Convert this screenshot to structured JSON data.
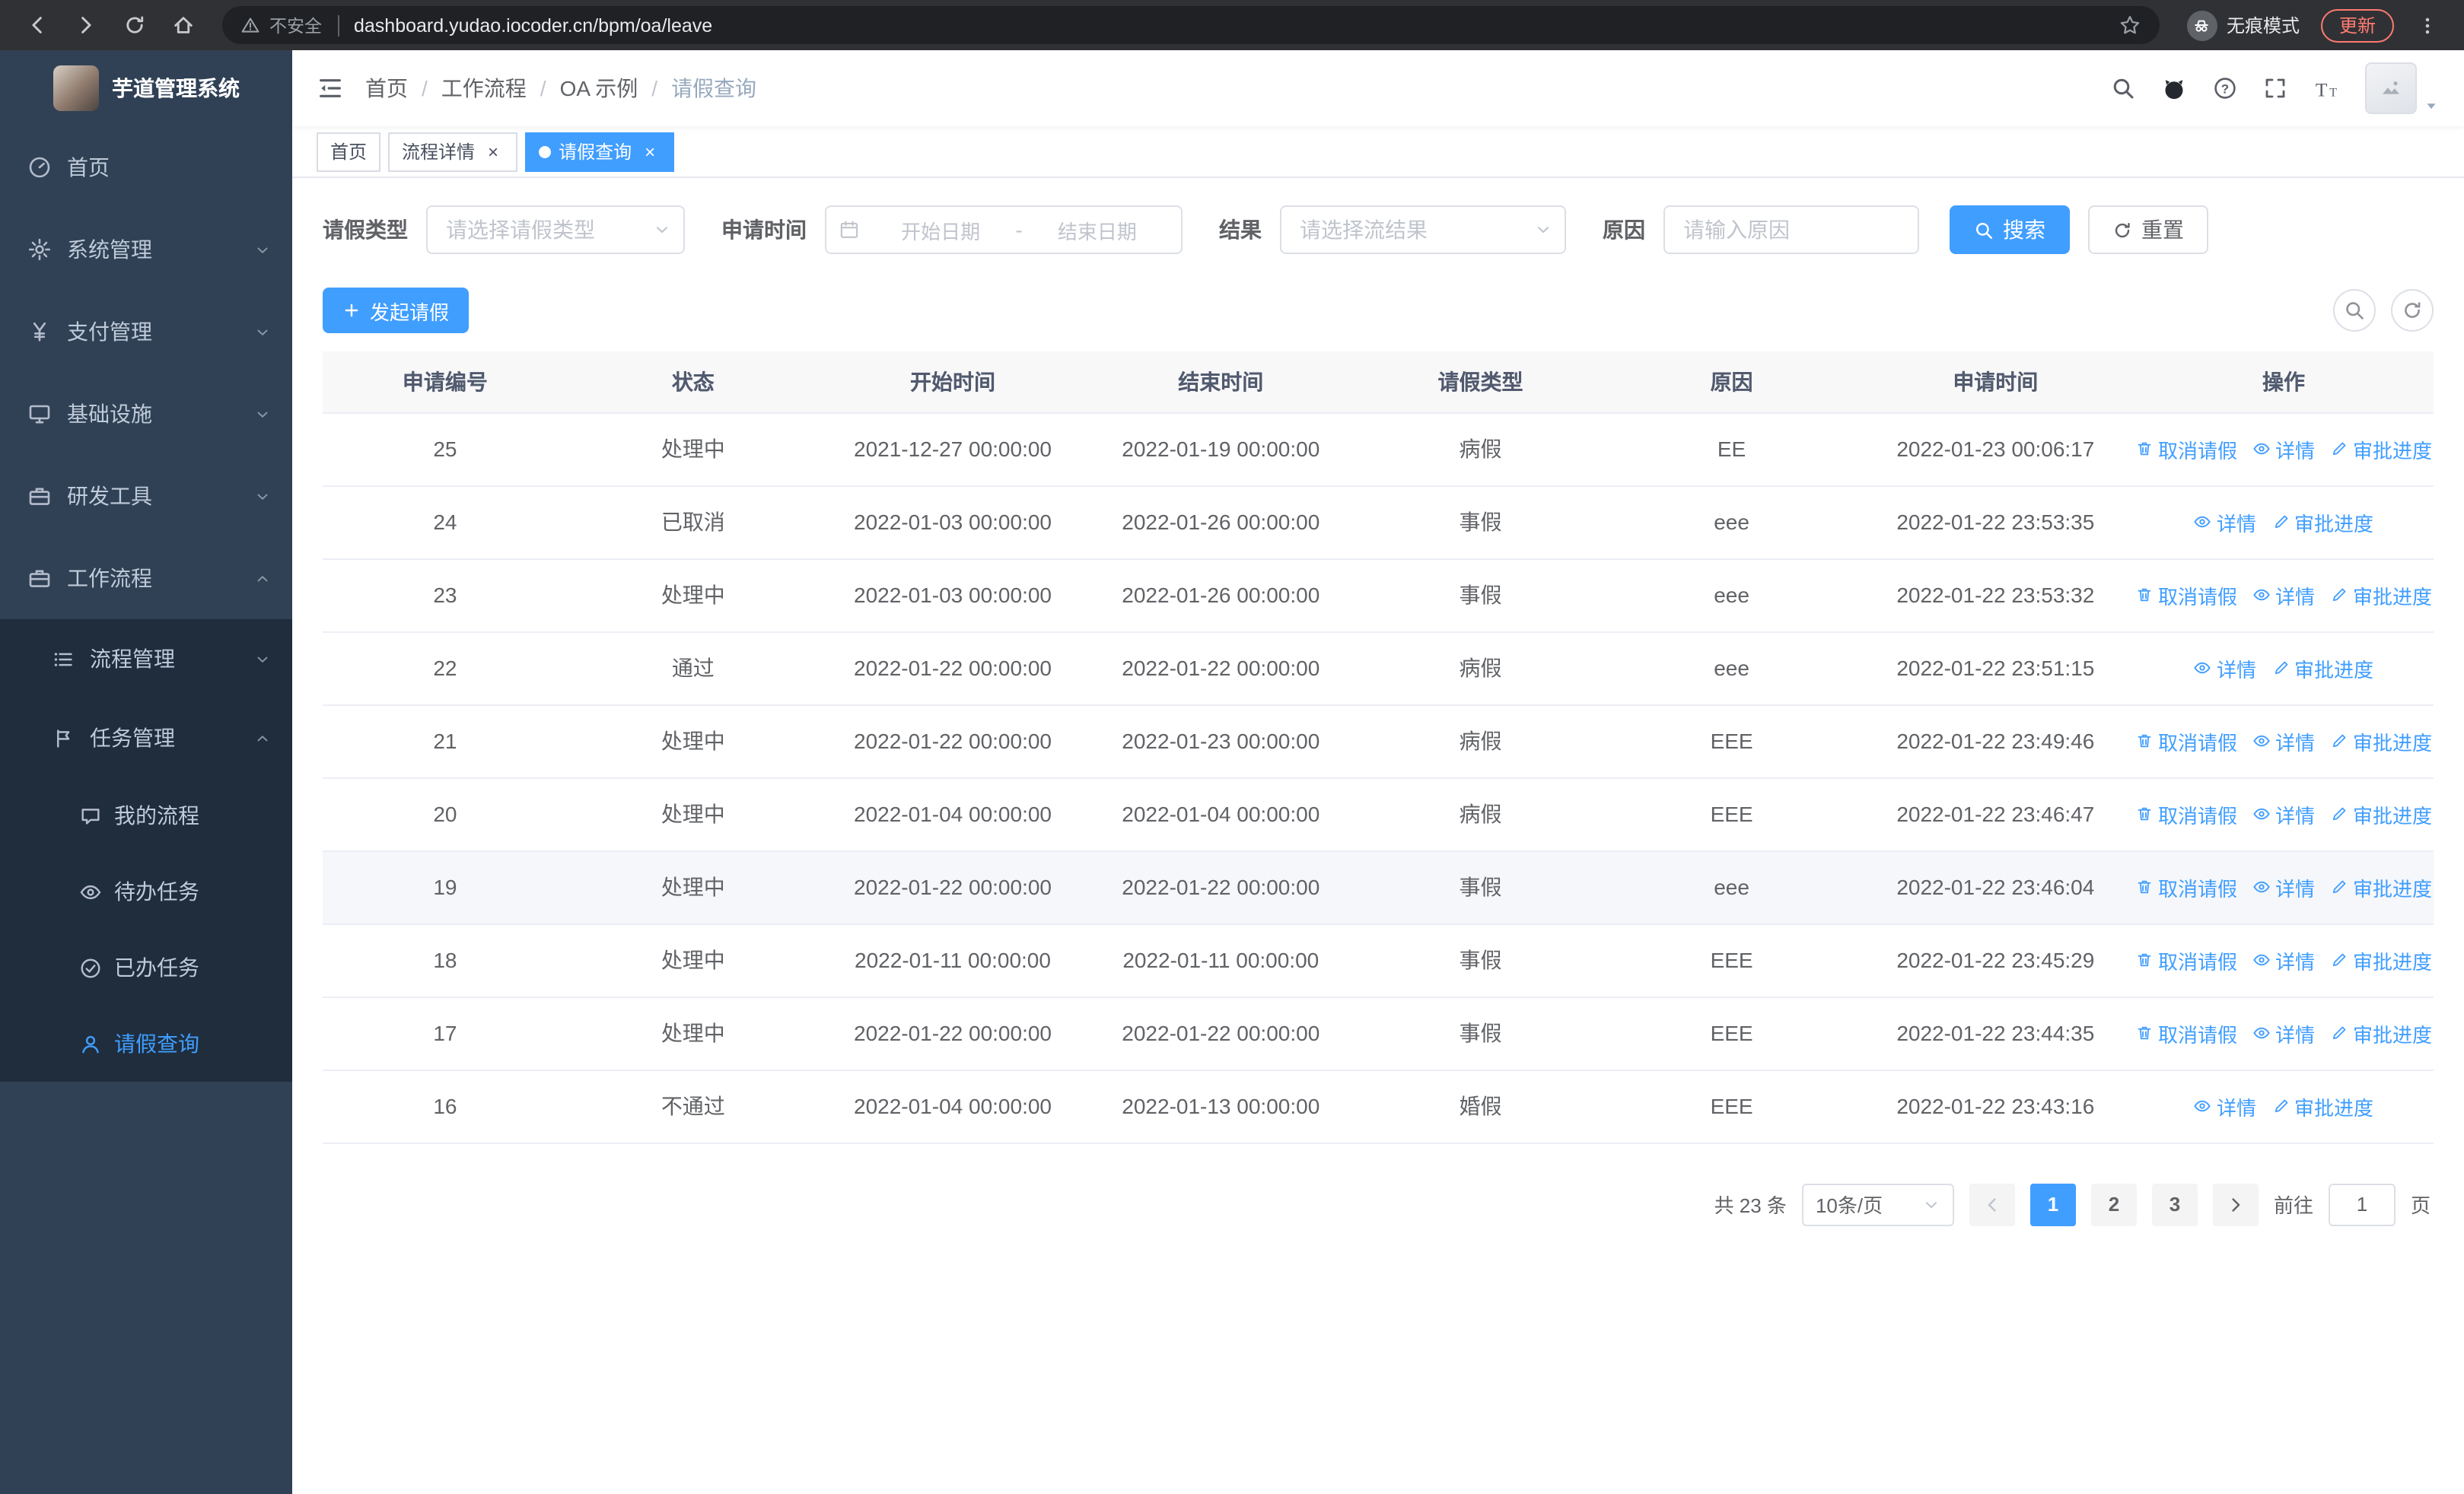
{
  "browser": {
    "security": "不安全",
    "url": "dashboard.yudao.iocoder.cn/bpm/oa/leave",
    "incognito": "无痕模式",
    "update": "更新"
  },
  "sidebar": {
    "logo_title": "芋道管理系统",
    "items": [
      {
        "label": "首页",
        "icon": "gauge-icon"
      },
      {
        "label": "系统管理",
        "icon": "gear-icon",
        "arrow": "down"
      },
      {
        "label": "支付管理",
        "icon": "yen-icon",
        "arrow": "down"
      },
      {
        "label": "基础设施",
        "icon": "monitor-icon",
        "arrow": "down"
      },
      {
        "label": "研发工具",
        "icon": "briefcase-icon",
        "arrow": "down"
      },
      {
        "label": "工作流程",
        "icon": "briefcase-icon",
        "arrow": "up",
        "expanded": true
      },
      {
        "label": "流程管理",
        "icon": "list-icon",
        "arrow": "down",
        "level": 2
      },
      {
        "label": "任务管理",
        "icon": "flag-icon",
        "arrow": "up",
        "level": 2,
        "expanded": true
      },
      {
        "label": "我的流程",
        "icon": "chat-icon",
        "level": 3
      },
      {
        "label": "待办任务",
        "icon": "eye-icon",
        "level": 3
      },
      {
        "label": "已办任务",
        "icon": "check-circle-icon",
        "level": 3
      },
      {
        "label": "请假查询",
        "icon": "user-icon",
        "level": 3,
        "active": true
      }
    ]
  },
  "header": {
    "breadcrumb": [
      "首页",
      "工作流程",
      "OA 示例",
      "请假查询"
    ],
    "breadcrumb_sep": "/"
  },
  "tabs": [
    {
      "label": "首页",
      "closable": false,
      "active": false
    },
    {
      "label": "流程详情",
      "closable": true,
      "active": false
    },
    {
      "label": "请假查询",
      "closable": true,
      "active": true
    }
  ],
  "filters": {
    "leave_type": {
      "label": "请假类型",
      "placeholder": "请选择请假类型"
    },
    "apply_time": {
      "label": "申请时间",
      "start_placeholder": "开始日期",
      "separator": "-",
      "end_placeholder": "结束日期"
    },
    "result": {
      "label": "结果",
      "placeholder": "请选择流结果"
    },
    "reason": {
      "label": "原因",
      "placeholder": "请输入原因"
    },
    "search_label": "搜索",
    "reset_label": "重置"
  },
  "toolbar": {
    "create_label": "发起请假"
  },
  "table": {
    "columns": [
      "申请编号",
      "状态",
      "开始时间",
      "结束时间",
      "请假类型",
      "原因",
      "申请时间",
      "操作"
    ],
    "actions": {
      "cancel": "取消请假",
      "detail": "详情",
      "progress": "审批进度"
    },
    "rows": [
      {
        "id": "25",
        "status": "处理中",
        "start": "2021-12-27 00:00:00",
        "end": "2022-01-19 00:00:00",
        "type": "病假",
        "reason": "EE",
        "applied": "2022-01-23 00:06:17",
        "cancelable": true
      },
      {
        "id": "24",
        "status": "已取消",
        "start": "2022-01-03 00:00:00",
        "end": "2022-01-26 00:00:00",
        "type": "事假",
        "reason": "eee",
        "applied": "2022-01-22 23:53:35",
        "cancelable": false
      },
      {
        "id": "23",
        "status": "处理中",
        "start": "2022-01-03 00:00:00",
        "end": "2022-01-26 00:00:00",
        "type": "事假",
        "reason": "eee",
        "applied": "2022-01-22 23:53:32",
        "cancelable": true
      },
      {
        "id": "22",
        "status": "通过",
        "start": "2022-01-22 00:00:00",
        "end": "2022-01-22 00:00:00",
        "type": "病假",
        "reason": "eee",
        "applied": "2022-01-22 23:51:15",
        "cancelable": false
      },
      {
        "id": "21",
        "status": "处理中",
        "start": "2022-01-22 00:00:00",
        "end": "2022-01-23 00:00:00",
        "type": "病假",
        "reason": "EEE",
        "applied": "2022-01-22 23:49:46",
        "cancelable": true
      },
      {
        "id": "20",
        "status": "处理中",
        "start": "2022-01-04 00:00:00",
        "end": "2022-01-04 00:00:00",
        "type": "病假",
        "reason": "EEE",
        "applied": "2022-01-22 23:46:47",
        "cancelable": true
      },
      {
        "id": "19",
        "status": "处理中",
        "start": "2022-01-22 00:00:00",
        "end": "2022-01-22 00:00:00",
        "type": "事假",
        "reason": "eee",
        "applied": "2022-01-22 23:46:04",
        "cancelable": true,
        "highlighted": true
      },
      {
        "id": "18",
        "status": "处理中",
        "start": "2022-01-11 00:00:00",
        "end": "2022-01-11 00:00:00",
        "type": "事假",
        "reason": "EEE",
        "applied": "2022-01-22 23:45:29",
        "cancelable": true
      },
      {
        "id": "17",
        "status": "处理中",
        "start": "2022-01-22 00:00:00",
        "end": "2022-01-22 00:00:00",
        "type": "事假",
        "reason": "EEE",
        "applied": "2022-01-22 23:44:35",
        "cancelable": true
      },
      {
        "id": "16",
        "status": "不通过",
        "start": "2022-01-04 00:00:00",
        "end": "2022-01-13 00:00:00",
        "type": "婚假",
        "reason": "EEE",
        "applied": "2022-01-22 23:43:16",
        "cancelable": false
      }
    ]
  },
  "pagination": {
    "total": "共 23 条",
    "page_size": "10条/页",
    "pages": [
      "1",
      "2",
      "3"
    ],
    "active_page": "1",
    "goto_label": "前往",
    "goto_value": "1",
    "page_unit": "页"
  },
  "icons": {
    "close": "×"
  },
  "colors": {
    "primary": "#409eff",
    "sidebar_bg": "#304156",
    "submenu_bg": "#1f2d3d",
    "update_accent": "#ff7b72"
  }
}
